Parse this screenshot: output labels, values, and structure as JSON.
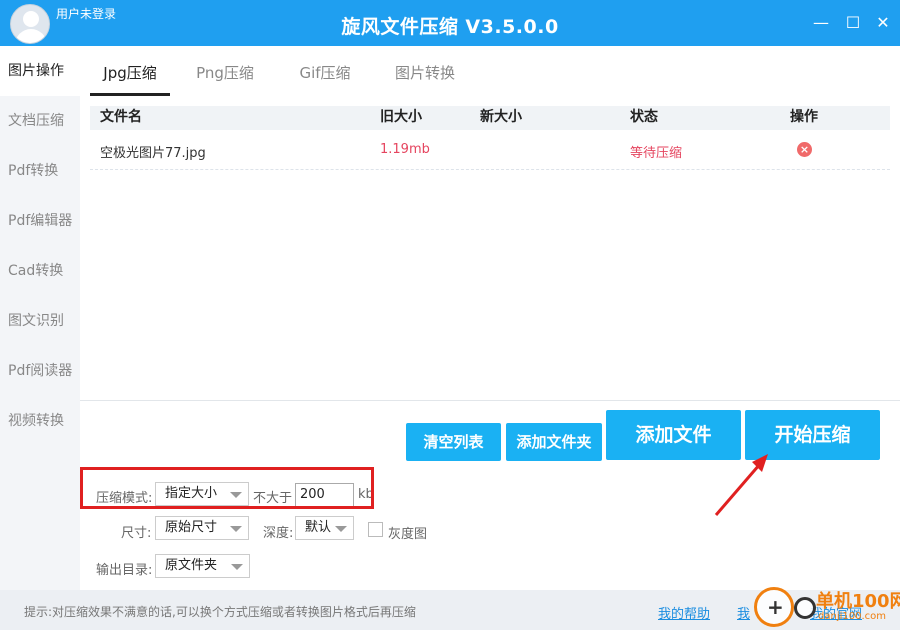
{
  "titlebar": {
    "user_label": "用户未登录",
    "title": "旋风文件压缩 V3.5.0.0",
    "min_icon": "—",
    "max_icon": "☐",
    "close_icon": "✕"
  },
  "sidebar": {
    "items": [
      {
        "label": "图片操作",
        "active": true
      },
      {
        "label": "文档压缩"
      },
      {
        "label": "Pdf转换"
      },
      {
        "label": "Pdf编辑器"
      },
      {
        "label": "Cad转换"
      },
      {
        "label": "图文识别"
      },
      {
        "label": "Pdf阅读器"
      },
      {
        "label": "视频转换"
      }
    ]
  },
  "tabs": [
    {
      "label": "Jpg压缩",
      "active": true
    },
    {
      "label": "Png压缩"
    },
    {
      "label": "Gif压缩"
    },
    {
      "label": "图片转换"
    }
  ],
  "table": {
    "headers": {
      "name": "文件名",
      "old_size": "旧大小",
      "new_size": "新大小",
      "status": "状态",
      "op": "操作"
    },
    "rows": [
      {
        "name": "空极光图片77.jpg",
        "old_size": "1.19mb",
        "new_size": "",
        "status": "等待压缩",
        "op_icon": "×"
      }
    ]
  },
  "buttons": {
    "clear": "清空列表",
    "add_folder": "添加文件夹",
    "add_file": "添加文件",
    "start": "开始压缩"
  },
  "options": {
    "mode_label": "压缩模式:",
    "mode_value": "指定大小",
    "limit_label": "不大于",
    "limit_value": "200",
    "limit_unit": "kb",
    "size_label": "尺寸:",
    "size_value": "原始尺寸",
    "depth_label": "深度:",
    "depth_value": "默认",
    "gray_label": "灰度图",
    "output_label": "输出目录:",
    "output_value": "原文件夹"
  },
  "footer": {
    "tip": "提示:对压缩效果不满意的话,可以换个方式压缩或者转换图片格式后再压缩",
    "help": "我的帮助",
    "feedback": "我",
    "site": "我的官网"
  },
  "watermark": {
    "text": "单机100网",
    "sub": "danji100.com"
  },
  "colors": {
    "titlebar": "#1f9ff0",
    "button": "#1ab1f3",
    "status_red": "#e5455f",
    "highlight": "#e02020"
  }
}
